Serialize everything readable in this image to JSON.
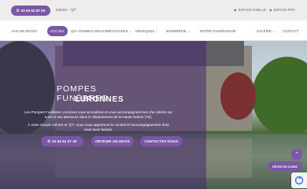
{
  "topbar": {
    "phone": "03 84 62 87 00",
    "phone_icon": "phone-icon",
    "hours": "24h/24 - 7j/7",
    "espace_famille": "ESPACE FAMILLE",
    "espace_pro": "ESPACE PRO"
  },
  "nav": {
    "items": [
      "AVIS DE DÉCÈS",
      "QUI SOMMES-NOUS",
      "PRÉVOYANCE",
      "OBSÈQUES",
      "MARBRERIE",
      "NOTRE FUNÉRARIUM",
      "GALERIE",
      "CONTACT"
    ],
    "active": "ACCUEIL"
  },
  "hero": {
    "title": "POMPES FUNÈBRES",
    "subtitle": "LURONNES",
    "p1": "Les Pompes Funèbres Luronnes vous accueillent et vous accompagnent lors d'un décès sur Lure et ses alentours dans le département de la Haute-Saône (70).",
    "p2": "À votre écoute 24h/24 et 7j/7, nous vous apportons le conseil et l'accompagnement dont vous avez besoin."
  },
  "buttons": {
    "phone": "03 84 62 87 00",
    "devis": "OBTENIR UN DEVIS",
    "contact": "CONTACTEZ-NOUS",
    "devis_side": "DEVIS EN LIGNE"
  },
  "colors": {
    "accent": "#7b57a8",
    "topbar_bg": "#efecec"
  }
}
